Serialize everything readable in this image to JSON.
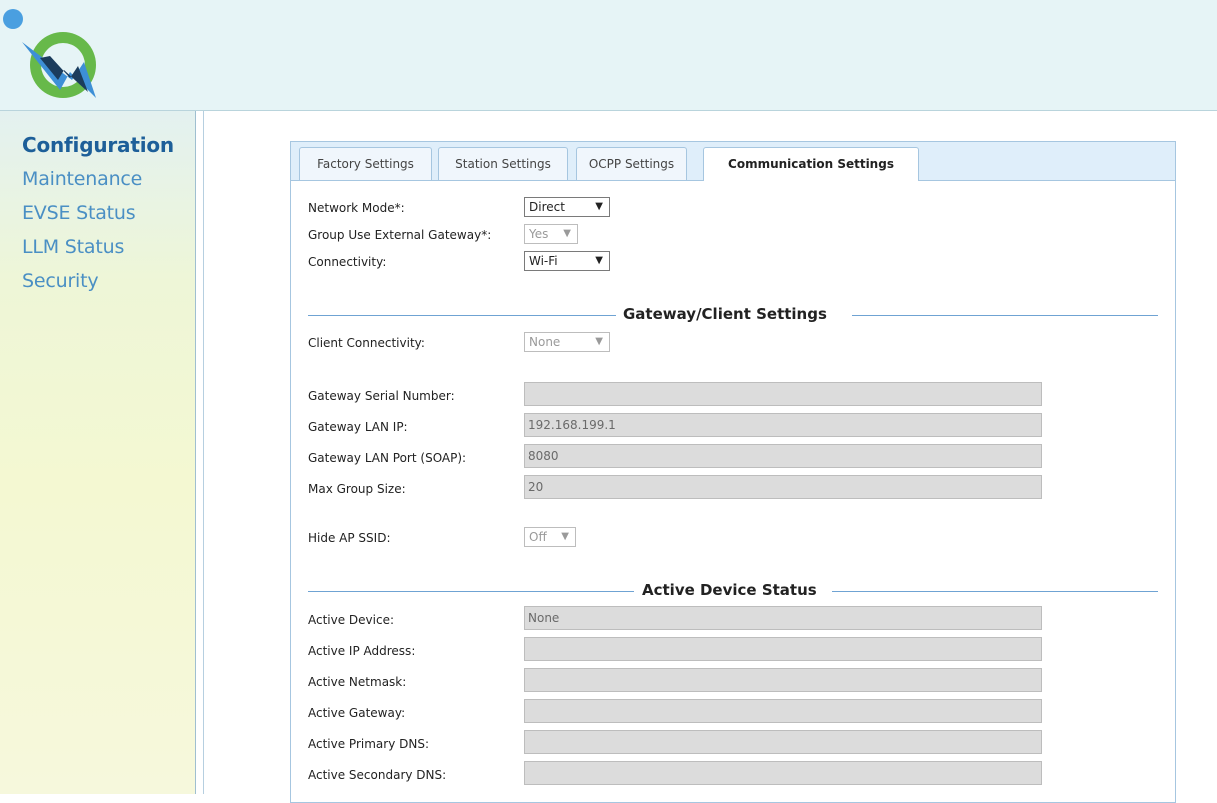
{
  "nav": {
    "items": [
      {
        "label": "Configuration",
        "active": true
      },
      {
        "label": "Maintenance"
      },
      {
        "label": "EVSE Status"
      },
      {
        "label": "LLM Status"
      },
      {
        "label": "Security"
      }
    ]
  },
  "tabs": [
    {
      "label": "Factory Settings"
    },
    {
      "label": "Station Settings"
    },
    {
      "label": "OCPP Settings"
    },
    {
      "label": "Communication Settings",
      "active": true
    }
  ],
  "form": {
    "network_mode": {
      "label": "Network Mode*:",
      "value": "Direct"
    },
    "group_external_gateway": {
      "label": "Group Use External Gateway*:",
      "value": "Yes"
    },
    "connectivity": {
      "label": "Connectivity:",
      "value": "Wi-Fi"
    }
  },
  "gateway": {
    "title": "Gateway/Client Settings",
    "client_connectivity": {
      "label": "Client Connectivity:",
      "value": "None"
    },
    "serial_number": {
      "label": "Gateway Serial Number:",
      "value": ""
    },
    "lan_ip": {
      "label": "Gateway LAN IP:",
      "value": "192.168.199.1"
    },
    "lan_port": {
      "label": "Gateway LAN Port (SOAP):",
      "value": "8080"
    },
    "max_group": {
      "label": "Max Group Size:",
      "value": "20"
    },
    "hide_ssid": {
      "label": "Hide AP SSID:",
      "value": "Off"
    }
  },
  "active": {
    "title": "Active Device Status",
    "device": {
      "label": "Active Device:",
      "value": "None"
    },
    "ip": {
      "label": "Active IP Address:",
      "value": ""
    },
    "netmask": {
      "label": "Active Netmask:",
      "value": ""
    },
    "gateway": {
      "label": "Active Gateway:",
      "value": ""
    },
    "primary_dns": {
      "label": "Active Primary DNS:",
      "value": ""
    },
    "secondary_dns": {
      "label": "Active Secondary DNS:",
      "value": ""
    }
  },
  "icons": {
    "dropdown": "triangle-down",
    "logo": "plug-bolt-logo"
  },
  "colors": {
    "nav_link": "#4a8fc4",
    "nav_active": "#1d5f99",
    "section_line": "#6fa3d3",
    "header_bg": "#e6f4f6"
  }
}
